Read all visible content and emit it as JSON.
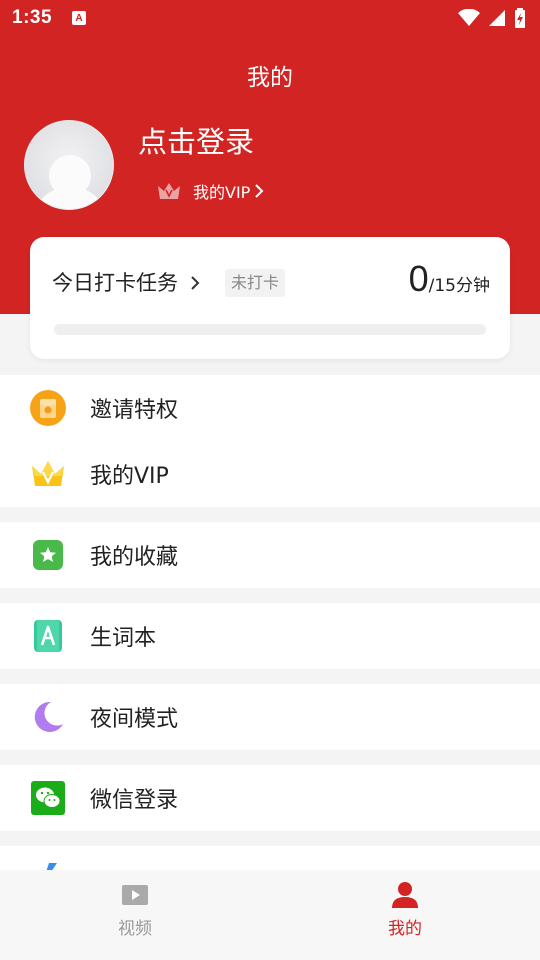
{
  "status_bar": {
    "time": "1:35",
    "notif_letter": "A"
  },
  "header": {
    "title": "我的",
    "login_text": "点击登录",
    "vip_link": "我的VIP"
  },
  "checkin": {
    "title": "今日打卡任务",
    "badge": "未打卡",
    "count": "0",
    "target": "/15分钟",
    "progress_fraction": 0
  },
  "menu": {
    "invite": "邀请特权",
    "vip": "我的VIP",
    "favorites": "我的收藏",
    "vocabulary": "生词本",
    "night_mode": "夜间模式",
    "wechat_login": "微信登录",
    "partial_item": ""
  },
  "nav": {
    "video": "视频",
    "mine": "我的"
  },
  "colors": {
    "brand_red": "#d32424",
    "wechat_green": "#1aad19"
  }
}
